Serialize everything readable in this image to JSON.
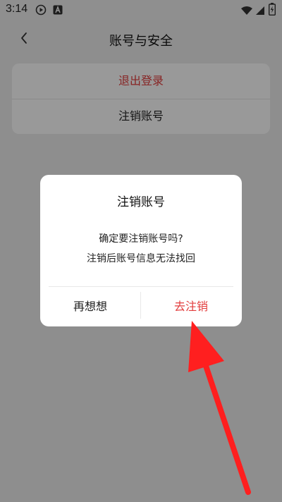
{
  "status_bar": {
    "time": "3:14",
    "icons": [
      "play-circle-icon",
      "a-letter-icon",
      "wifi-icon",
      "cellular-signal-icon",
      "battery-charging-icon"
    ]
  },
  "nav": {
    "back_icon": "chevron-left-icon",
    "title": "账号与安全"
  },
  "settings": {
    "items": [
      {
        "label": "退出登录",
        "color": "#e23c3c"
      },
      {
        "label": "注销账号",
        "color": "#222222"
      }
    ]
  },
  "dialog": {
    "title": "注销账号",
    "message_line1": "确定要注销账号吗?",
    "message_line2": "注销后账号信息无法找回",
    "cancel_label": "再想想",
    "confirm_label": "去注销",
    "confirm_color": "#e23c3c"
  },
  "annotation": {
    "icon": "red-arrow-icon",
    "color": "#ff1f1f"
  }
}
